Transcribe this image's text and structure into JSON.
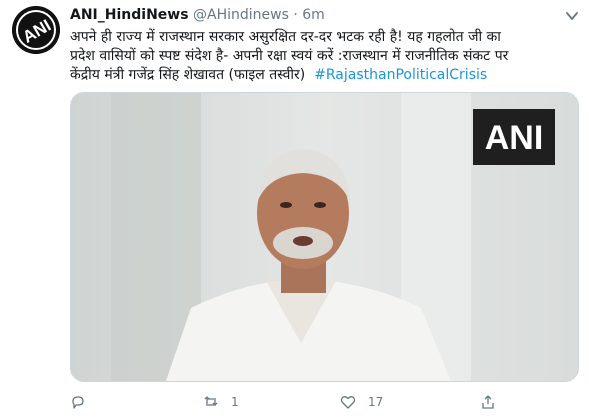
{
  "tweet": {
    "author_name": "ANI_HindiNews",
    "handle": "@AHindinews",
    "separator": "·",
    "time": "6m",
    "text_line1": "अपने ही राज्य में राजस्थान सरकार असुरक्षित दर-दर भटक रही है! यह गहलोत जी का",
    "text_line2": "प्रदेश वासियों को स्पष्ट संदेश है- अपनी रक्षा स्वयं करें :राजस्थान में राजनीतिक संकट पर",
    "text_line3_prefix": "केंद्रीय मंत्री गजेंद्र सिंह शेखावत (फाइल तस्वीर)",
    "hashtag": "#RajasthanPoliticalCrisis",
    "media_watermark": "ANI",
    "avatar_text": "ANI"
  },
  "actions": {
    "reply_count": "",
    "retweet_count": "1",
    "like_count": "17"
  },
  "colors": {
    "link": "#1b95e0",
    "muted": "#657786",
    "text": "#14171a"
  },
  "icons": [
    "ani-logo-icon",
    "chevron-down-icon",
    "reply-icon",
    "retweet-icon",
    "like-icon",
    "share-icon"
  ]
}
